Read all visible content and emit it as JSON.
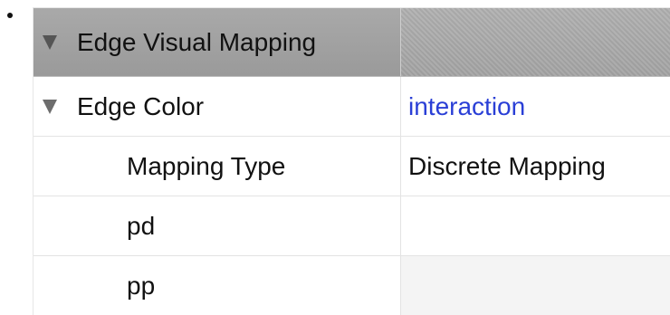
{
  "panel": {
    "header": {
      "label": "Edge Visual Mapping",
      "value": ""
    },
    "edge_color": {
      "label": "Edge Color",
      "value": "interaction"
    },
    "rows": [
      {
        "label": "Mapping Type",
        "value": "Discrete Mapping"
      },
      {
        "label": "pd",
        "value": ""
      },
      {
        "label": "pp",
        "value": ""
      }
    ]
  },
  "colors": {
    "header_bg": "#a0a0a0",
    "link_blue": "#2a3fd6",
    "triangle": "#6d6d6d"
  }
}
